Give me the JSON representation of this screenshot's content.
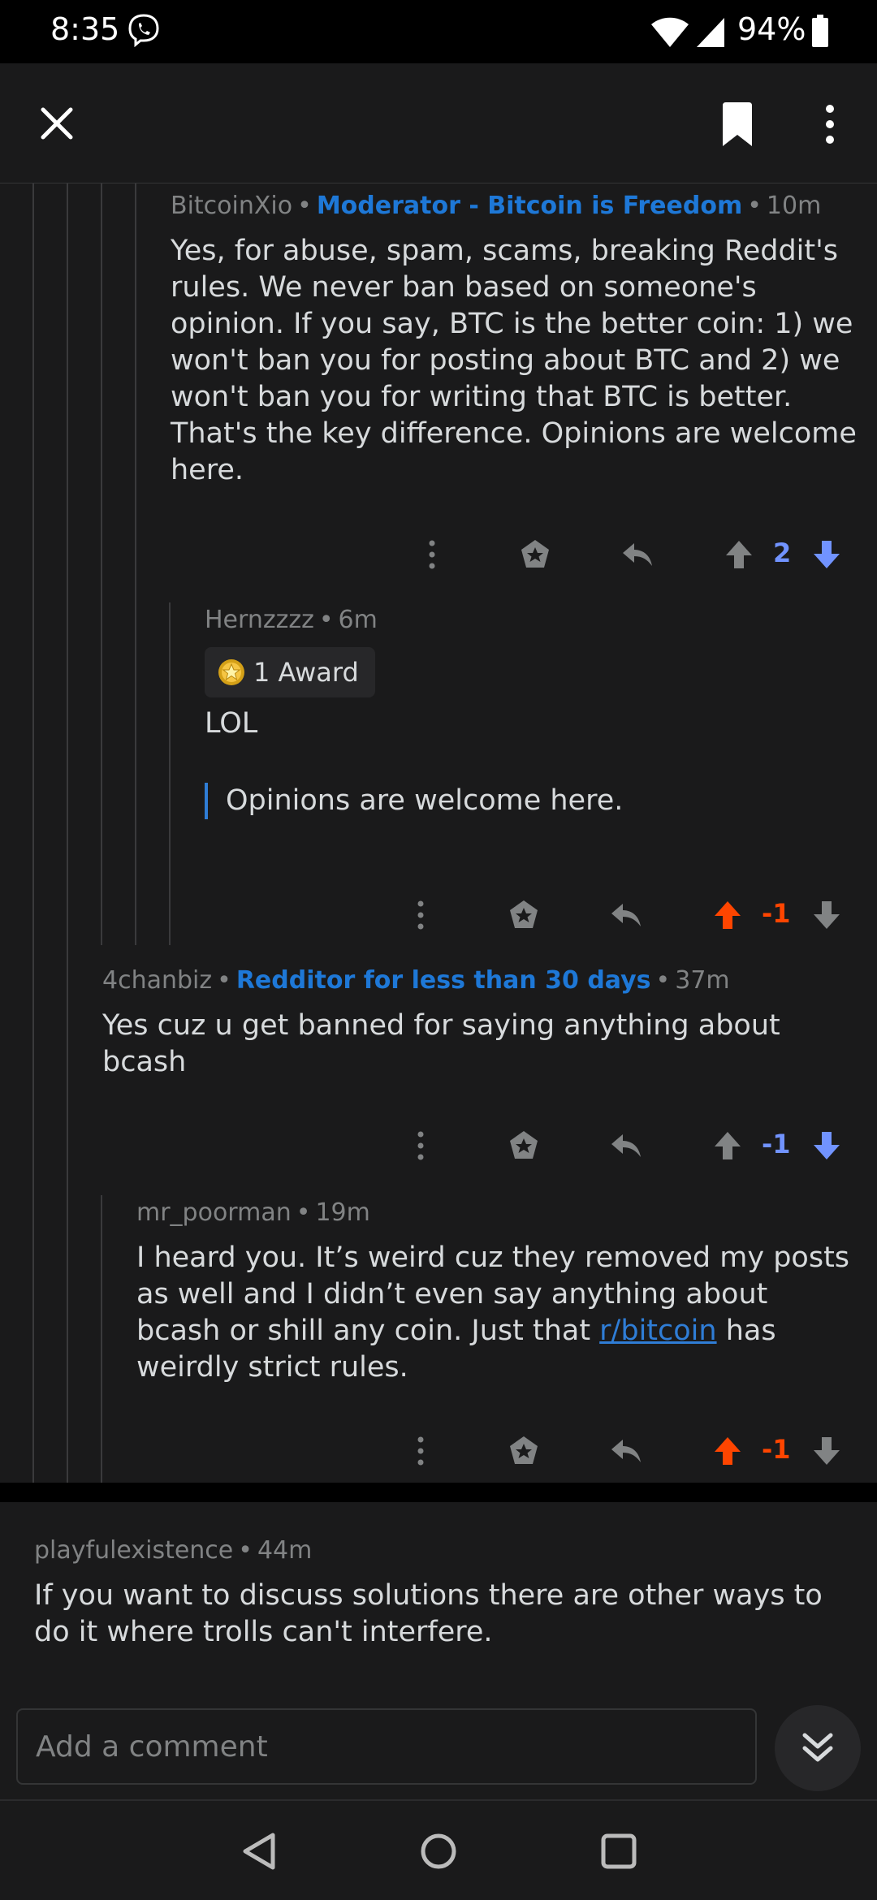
{
  "status_bar": {
    "time": "8:35",
    "battery": "94%"
  },
  "colors": {
    "upvote": "#ff4500",
    "downvote": "#7193ff",
    "flair": "#1e78d7",
    "link": "#2f7dd6"
  },
  "comments": [
    {
      "author": "BitcoinXio",
      "flair": "Moderator - Bitcoin is Freedom",
      "age": "10m",
      "body": "Yes, for abuse, spam, scams, breaking Reddit's rules. We never ban based on someone's opinion. If you say, BTC is the better coin: 1) we won't ban you for posting about BTC and 2) we won't ban you for writing that BTC is better. That's the key difference. Opinions are welcome here.",
      "score": "2",
      "vote_state": "down"
    },
    {
      "author": "Hernzzzz",
      "age": "6m",
      "award": "1 Award",
      "body": "LOL",
      "quote": "Opinions are welcome here.",
      "score": "-1",
      "vote_state": "up"
    },
    {
      "author": "4chanbiz",
      "flair": "Redditor for less than 30 days",
      "age": "37m",
      "body": "Yes cuz u get banned for saying anything about bcash",
      "score": "-1",
      "vote_state": "down"
    },
    {
      "author": "mr_poorman",
      "age": "19m",
      "body_before": "I heard you.  It’s weird cuz they removed my posts as well and I didn’t even say anything about bcash or shill any coin.  Just that ",
      "link": "r/bitcoin",
      "body_after": " has weirdly strict rules.",
      "score": "-1",
      "vote_state": "up"
    },
    {
      "author": "playfulexistence",
      "age": "44m",
      "body": "If you want to discuss solutions there are other ways to do it where trolls can't interfere."
    }
  ],
  "composer": {
    "placeholder": "Add a comment"
  },
  "icons": [
    "close-icon",
    "bookmark-icon",
    "more-vert-icon",
    "award-icon",
    "reply-icon",
    "upvote-icon",
    "downvote-icon",
    "double-chevron-down-icon",
    "back-icon",
    "home-icon",
    "recents-icon"
  ]
}
